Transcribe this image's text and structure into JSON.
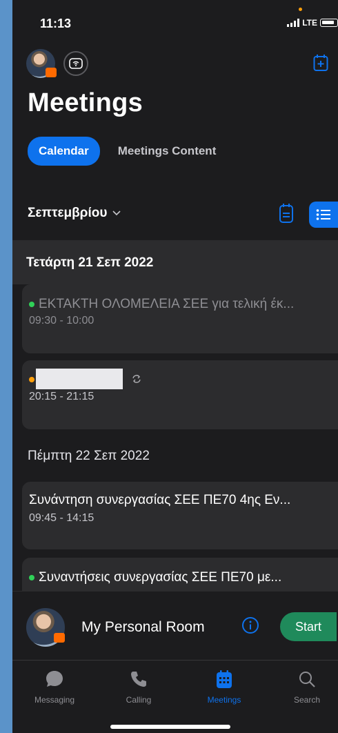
{
  "status": {
    "time": "11:13",
    "network": "LTE"
  },
  "header": {
    "title": "Meetings"
  },
  "tabs": {
    "calendar": "Calendar",
    "content": "Meetings Content"
  },
  "month": {
    "label": "Σεπτεμβρίου"
  },
  "days": [
    {
      "header": "Τετάρτη 21 Σεπ 2022",
      "meetings": [
        {
          "title": "ΕΚΤΑΚΤΗ ΟΛΟΜΕΛΕΙΑ ΣΕΕ για τελική έκ...",
          "time": "09:30 - 10:00"
        },
        {
          "title": "",
          "time": "20:15 - 21:15"
        }
      ]
    },
    {
      "header": "Πέμπτη 22 Σεπ 2022",
      "meetings": [
        {
          "title": "Συνάντηση συνεργασίας ΣΕΕ ΠΕ70 4ης Εν...",
          "time": "09:45 - 14:15"
        },
        {
          "title": "Συναντήσεις συνεργασίας ΣΕΕ ΠΕ70 με...",
          "time": ""
        }
      ]
    }
  ],
  "personal_room": {
    "label": "My Personal Room",
    "start": "Start"
  },
  "tabbar": {
    "messaging": "Messaging",
    "calling": "Calling",
    "meetings": "Meetings",
    "search": "Search"
  },
  "colors": {
    "accent": "#0e72ed",
    "start": "#1f8a5b",
    "online": "#30d158",
    "recurring": "#ff9f0a"
  }
}
